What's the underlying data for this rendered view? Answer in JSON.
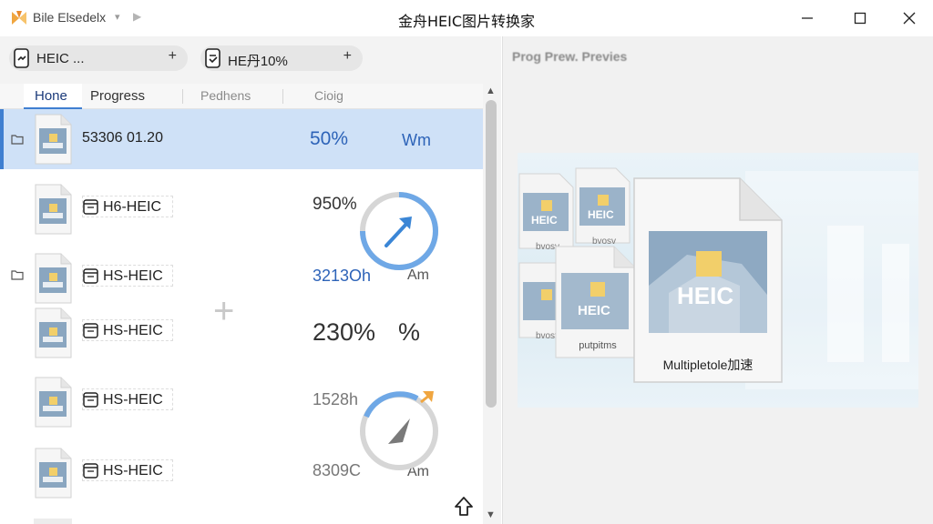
{
  "titlebar": {
    "app_name": "Bile Elsedelx",
    "dropdown_glyph": "▾",
    "forward_glyph": "▶",
    "window_title": "金舟HEIC图片转换家"
  },
  "doc_tabs": [
    {
      "label": "HEIC ...",
      "add": "+"
    },
    {
      "label": "HE丹10%",
      "add": "+"
    }
  ],
  "columns": {
    "home": "Hone",
    "progress": "Progress",
    "pathers": "Pedhens",
    "cioig": "Cioig"
  },
  "rows": [
    {
      "name": "53306 01.20",
      "pct": "50%",
      "unit": "Wm"
    },
    {
      "name": "H6-HEIC",
      "pct": "950%"
    },
    {
      "name": "HS-HEIC",
      "pct": "3213Oh",
      "unit": "Am"
    },
    {
      "name": "HS-HEIC",
      "pct": "230%",
      "unit": "%"
    },
    {
      "name": "HS-HEIC",
      "pct": "1528h"
    },
    {
      "name": "HS-HEIC",
      "pct": "8309C",
      "unit": "Am"
    }
  ],
  "ghost_plus": "+",
  "scroll": {
    "up": "▲",
    "down": "▼"
  },
  "preview": {
    "title": "Prog Prew. Previes",
    "badge": "HEIC",
    "main_label": "Multipletole加速",
    "small_caption_1": "bvosv",
    "small_caption_2": "bvosv",
    "small_caption_3": "bvosv",
    "small_caption_4": "putpitms"
  },
  "colors": {
    "accent": "#3f7fd1",
    "selected_row": "#cfe1f7",
    "badge_yellow": "#f2cf6a",
    "logo_orange": "#f0a640"
  }
}
